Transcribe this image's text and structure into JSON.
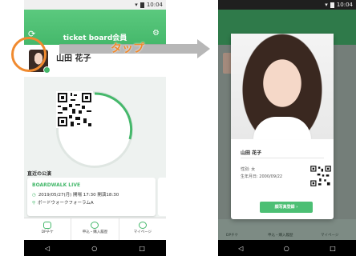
{
  "status": {
    "time": "10:04"
  },
  "left": {
    "header_title": "ticket board会員",
    "member_name": "山田 花子",
    "recent_heading": "直近の公演",
    "event": {
      "name": "BOARDWALK LIVE",
      "datetime": "2019/05/27(月) 開場 17:30 開演18:30",
      "venue": "ボードウォークフォーラムA"
    },
    "tabs": [
      {
        "label": "DPチケ"
      },
      {
        "label": "申込・購入履歴"
      },
      {
        "label": "マイページ"
      }
    ]
  },
  "annotation": {
    "tap_label": "タップ"
  },
  "modal": {
    "name": "山田 花子",
    "gender_line": "性別: 女",
    "dob_line": "生年月日: 2000/09/22",
    "button_label": "顔写真登録"
  },
  "right_tabs": [
    {
      "label": "DPチケ"
    },
    {
      "label": "申込・購入履歴"
    },
    {
      "label": "マイページ"
    }
  ],
  "colors": {
    "accent": "#45b86b",
    "annotation": "#f08a2f"
  }
}
